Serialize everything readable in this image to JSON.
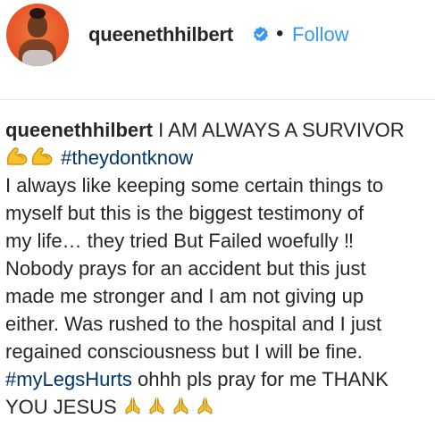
{
  "profile": {
    "username": "queenethhilbert",
    "separator": "•",
    "follow_label": "Follow",
    "verified_icon": "verified-badge-icon",
    "avatar_icon": "profile-avatar"
  },
  "post": {
    "author": "queenethhilbert",
    "lines": [
      "I AM ALWAYS A SURVIVOR",
      "I always like keeping some certain things to",
      "myself but this is the biggest testimony of",
      "my life… they tried But Failed woefully ‼",
      "Nobody prays for an accident but this just",
      "made me stronger and I am not giving up",
      "either. Was rushed to the hospital and I just",
      "regained consciousness but I will be fine.",
      "ohhh pls pray for me THANK",
      "YOU JESUS"
    ],
    "hashtags": {
      "first": "#theydontknow",
      "second": "#myLegsHurts"
    },
    "emoji": {
      "muscle": "flexed-biceps-icon",
      "pray": "folded-hands-icon"
    }
  },
  "colors": {
    "link": "#3897f0",
    "hashtag": "#003569",
    "text": "#262626",
    "divider": "#e6e6e6",
    "verified": "#3897f0"
  }
}
